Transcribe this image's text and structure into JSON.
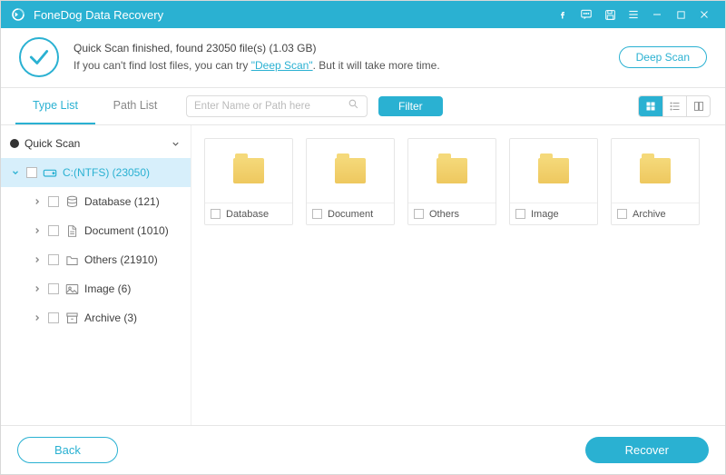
{
  "app": {
    "title": "FoneDog Data Recovery"
  },
  "status": {
    "line1_prefix": "Quick Scan finished, found ",
    "file_count": "23050",
    "line1_mid": " file(s) (",
    "size": "1.03 GB",
    "line1_suffix": ")",
    "line2_prefix": "If you can't find lost files, you can try ",
    "link_text": "\"Deep Scan\"",
    "line2_suffix": ". But it will take more time.",
    "deep_scan_btn": "Deep Scan"
  },
  "toolbar": {
    "tab_type": "Type List",
    "tab_path": "Path List",
    "search_placeholder": "Enter Name or Path here",
    "filter_btn": "Filter"
  },
  "tree": {
    "quick_scan": "Quick Scan",
    "drive": "C:(NTFS) (23050)",
    "children": [
      {
        "label": "Database (121)"
      },
      {
        "label": "Document (1010)"
      },
      {
        "label": "Others (21910)"
      },
      {
        "label": "Image (6)"
      },
      {
        "label": "Archive (3)"
      }
    ]
  },
  "folders": [
    {
      "label": "Database"
    },
    {
      "label": "Document"
    },
    {
      "label": "Others"
    },
    {
      "label": "Image"
    },
    {
      "label": "Archive"
    }
  ],
  "footer": {
    "back": "Back",
    "recover": "Recover"
  },
  "colors": {
    "accent": "#2ab1d2"
  }
}
